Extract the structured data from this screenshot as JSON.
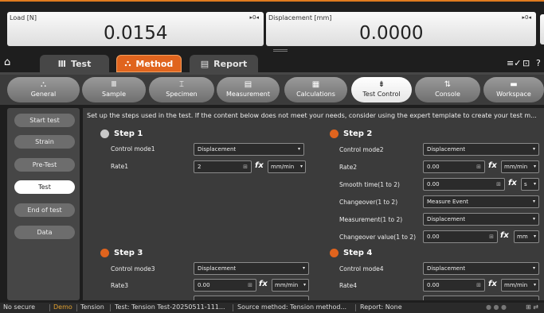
{
  "load_panel": {
    "label": "Load [N]",
    "value": "0.0154",
    "mark": "▸0◂"
  },
  "disp_panel": {
    "label": "Displacement [mm]",
    "value": "0.0000",
    "mark": "▸0◂"
  },
  "tabs": [
    {
      "label": "Test"
    },
    {
      "label": "Method"
    },
    {
      "label": "Report"
    }
  ],
  "ribbon": [
    {
      "label": "General",
      "icon": "⛬"
    },
    {
      "label": "Sample",
      "icon": "Ⅲ"
    },
    {
      "label": "Specimen",
      "icon": "⌶"
    },
    {
      "label": "Measurement",
      "icon": "▤"
    },
    {
      "label": "Calculations",
      "icon": "▦"
    },
    {
      "label": "Test Control",
      "icon": "⇟"
    },
    {
      "label": "Console",
      "icon": "⇅"
    },
    {
      "label": "Workspace",
      "icon": "▬"
    }
  ],
  "sidebar": [
    {
      "label": "Start test"
    },
    {
      "label": "Strain"
    },
    {
      "label": "Pre-Test"
    },
    {
      "label": "Test"
    },
    {
      "label": "End of test"
    },
    {
      "label": "Data"
    }
  ],
  "intro": "Set up the steps used in the test. If the content below does not meet your needs, consider using the expert template to create your test m...",
  "steps": {
    "s1": {
      "title": "Step 1",
      "control_label": "Control mode1",
      "control_value": "Displacement",
      "rate_label": "Rate1",
      "rate_value": "2",
      "rate_unit": "mm/min"
    },
    "s2": {
      "title": "Step 2",
      "control_label": "Control mode2",
      "control_value": "Displacement",
      "rate_label": "Rate2",
      "rate_value": "0.00",
      "rate_unit": "mm/min",
      "smooth_label": "Smooth time(1 to 2)",
      "smooth_value": "0.00",
      "smooth_unit": "s",
      "changeover_label": "Changeover(1 to 2)",
      "changeover_value": "Measure Event",
      "measurement_label": "Measurement(1 to 2)",
      "measurement_value": "Displacement",
      "cvalue_label": "Changeover value(1 to 2)",
      "cvalue_value": "0.00",
      "cvalue_unit": "mm"
    },
    "s3": {
      "title": "Step 3",
      "control_label": "Control mode3",
      "control_value": "Displacement",
      "rate_label": "Rate3",
      "rate_value": "0.00",
      "rate_unit": "mm/min"
    },
    "s4": {
      "title": "Step 4",
      "control_label": "Control mode4",
      "control_value": "Displacement",
      "rate_label": "Rate4",
      "rate_value": "0.00",
      "rate_unit": "mm/min"
    }
  },
  "fx": "fx",
  "status": {
    "security": "No secure",
    "mode": "Demo",
    "type": "Tension",
    "test": "Test: Tension Test-20250511-111...",
    "source": "Source method: Tension method...",
    "report": "Report: None"
  },
  "colors": {
    "accent": "#e0641e",
    "demo": "#e0a030"
  }
}
